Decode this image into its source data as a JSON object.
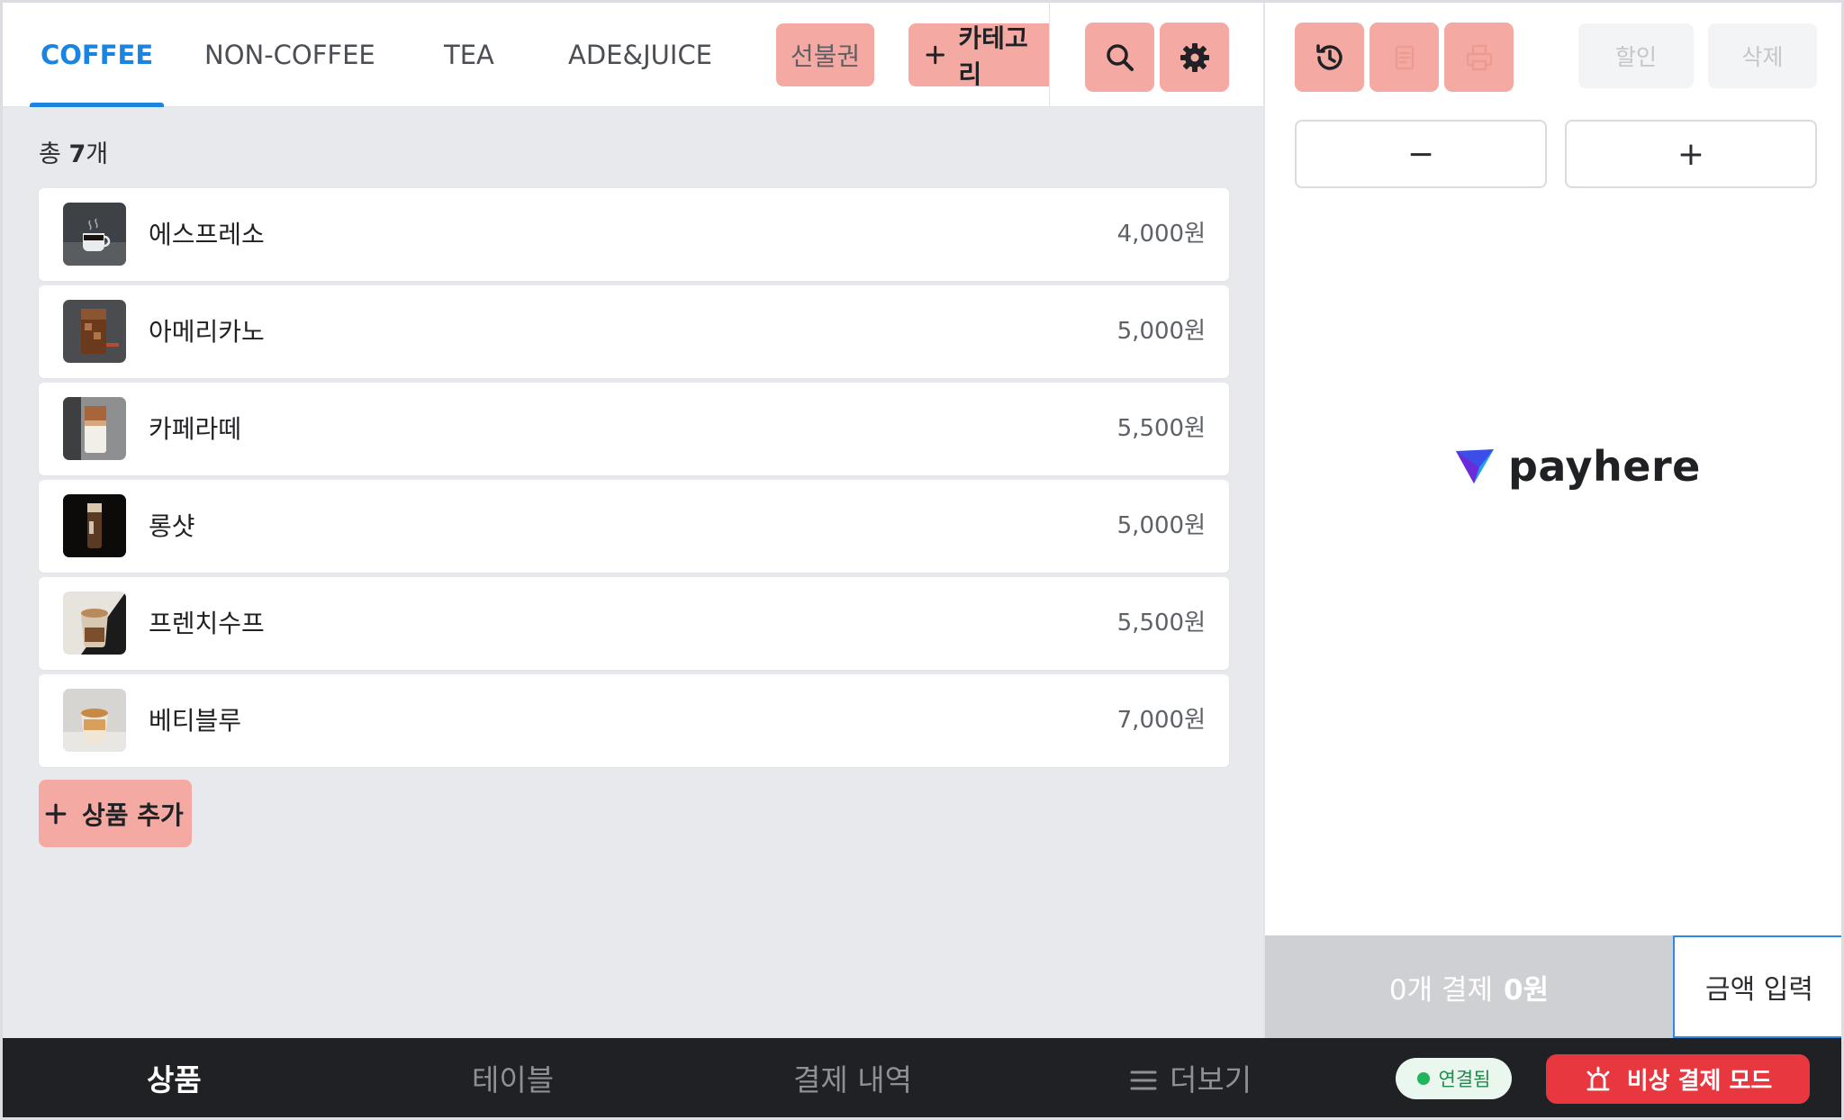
{
  "tabs": [
    {
      "label": "COFFEE",
      "active": true
    },
    {
      "label": "NON-COFFEE",
      "active": false
    },
    {
      "label": "TEA",
      "active": false
    },
    {
      "label": "ADE&JUICE",
      "active": false
    }
  ],
  "toolbar": {
    "voucher_label": "선불권",
    "add_category_label": "카테고리",
    "search_icon": "search-icon",
    "settings_icon": "gear-icon"
  },
  "count": {
    "prefix": "총 ",
    "number": "7",
    "suffix": "개"
  },
  "products": [
    {
      "name": "에스프레소",
      "price": "4,000원"
    },
    {
      "name": "아메리카노",
      "price": "5,000원"
    },
    {
      "name": "카페라떼",
      "price": "5,500원"
    },
    {
      "name": "롱샷",
      "price": "5,000원"
    },
    {
      "name": "프렌치수프",
      "price": "5,500원"
    },
    {
      "name": "베티블루",
      "price": "7,000원"
    }
  ],
  "add_product_label": "상품 추가",
  "order_panel": {
    "history_icon": "history-icon",
    "receipt_icon": "receipt-icon",
    "print_icon": "printer-icon",
    "discount_label": "할인",
    "delete_label": "삭제",
    "minus_label": "−",
    "plus_label": "+",
    "logo_text": "payhere",
    "pay_count": "0개 결제",
    "pay_amount": "0원",
    "amount_input_label": "금액 입력"
  },
  "bottom_nav": {
    "items": [
      "상품",
      "테이블",
      "결제 내역",
      "더보기"
    ],
    "active_index": 0,
    "connection_status": "연결됨",
    "emergency_label": "비상 결제 모드"
  },
  "colors": {
    "accent": "#1a84e0",
    "chip": "#f4aaa3",
    "danger": "#e8373f",
    "connected": "#1fb55b"
  }
}
